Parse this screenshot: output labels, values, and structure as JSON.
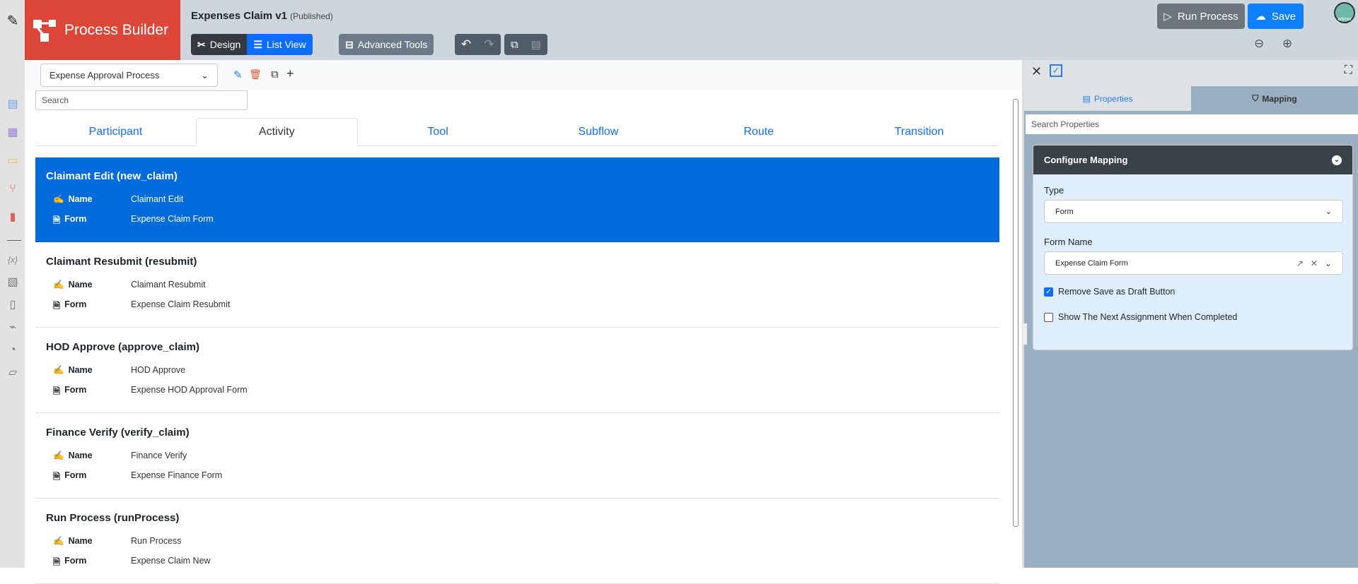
{
  "app": {
    "name": "Process Builder",
    "process_title": "Expenses Claim v1",
    "status": "(Published)"
  },
  "toolbar": {
    "design": "Design",
    "list_view": "List View",
    "advanced_tools": "Advanced Tools",
    "run_process": "Run Process",
    "save": "Save",
    "avatar": "admin"
  },
  "process_select": {
    "value": "Expense Approval Process"
  },
  "search": {
    "placeholder": "Search"
  },
  "tabs": [
    "Participant",
    "Activity",
    "Tool",
    "Subflow",
    "Route",
    "Transition"
  ],
  "active_tab": "Activity",
  "field_labels": {
    "name": "Name",
    "form": "Form"
  },
  "activities": [
    {
      "title": "Claimant Edit (new_claim)",
      "name": "Claimant Edit",
      "form": "Expense Claim Form"
    },
    {
      "title": "Claimant Resubmit (resubmit)",
      "name": "Claimant Resubmit",
      "form": "Expense Claim Resubmit"
    },
    {
      "title": "HOD Approve (approve_claim)",
      "name": "HOD Approve",
      "form": "Expense HOD Approval Form"
    },
    {
      "title": "Finance Verify (verify_claim)",
      "name": "Finance Verify",
      "form": "Expense Finance Form"
    },
    {
      "title": "Run Process (runProcess)",
      "name": "Run Process",
      "form": "Expense Claim New"
    }
  ],
  "panel": {
    "tab_properties": "Properties",
    "tab_mapping": "Mapping",
    "search_placeholder": "Search Properties",
    "card_title": "Configure Mapping",
    "type_label": "Type",
    "type_value": "Form",
    "form_name_label": "Form Name",
    "form_name_value": "Expense Claim Form",
    "remove_draft": "Remove Save as Draft Button",
    "remove_draft_checked": true,
    "show_next": "Show The Next Assignment When Completed",
    "show_next_checked": false
  },
  "colors": {
    "brand": "#dc4638",
    "primary": "#0d6efd",
    "selected": "#006bdb"
  }
}
